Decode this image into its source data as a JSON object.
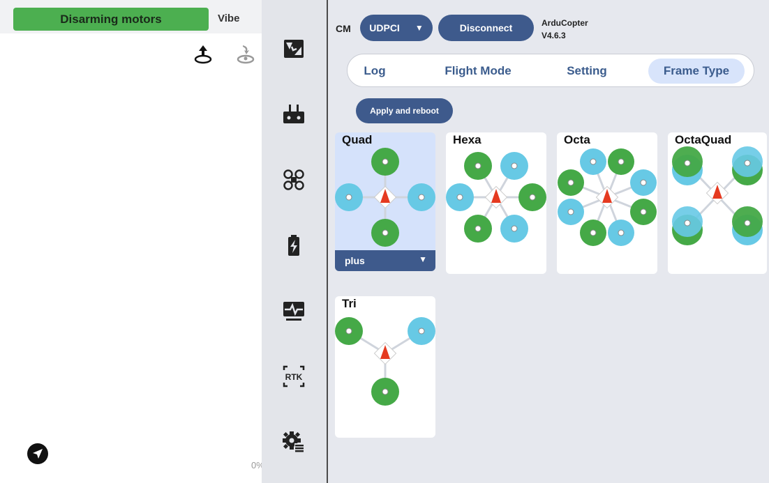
{
  "status": {
    "text": "Disarming motors",
    "vibe": "Vibe",
    "percent": "0%"
  },
  "left_icons": [
    "upload-icon",
    "drone-upload-icon",
    "send-icon"
  ],
  "rail": [
    "map-icon",
    "remote-controller-icon",
    "drone-icon",
    "battery-icon",
    "monitor-icon",
    "rtk-icon",
    "settings-icon"
  ],
  "rail_rtk_text": "RTK",
  "toolbar": {
    "cm": "CM",
    "port": "UDPCI",
    "disconnect": "Disconnect",
    "firmware": "ArduCopter",
    "version": "V4.6.3"
  },
  "tabs": [
    "Log",
    "Flight Mode",
    "Setting",
    "Frame Type"
  ],
  "active_tab": "Frame Type",
  "apply_label": "Apply and reboot",
  "frames": [
    {
      "name": "Quad",
      "selected": true,
      "variant": "plus"
    },
    {
      "name": "Hexa"
    },
    {
      "name": "Octa"
    },
    {
      "name": "OctaQuad"
    },
    {
      "name": "Tri"
    }
  ],
  "colors": {
    "cw_motor": "#45a947",
    "ccw_motor": "#67c9e5",
    "accent": "#3e5a8c",
    "status_green": "#4caf50",
    "arrow": "#e53a20"
  }
}
